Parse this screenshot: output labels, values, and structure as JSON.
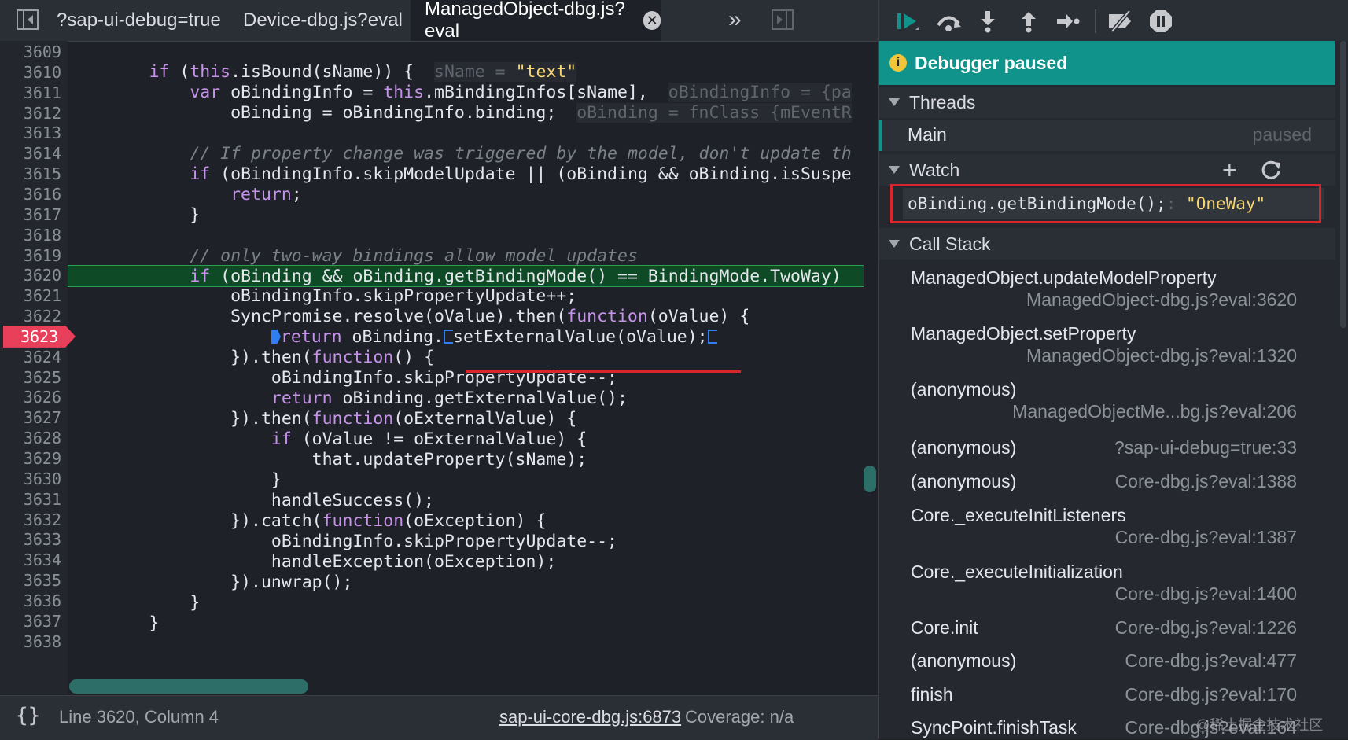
{
  "tabs": [
    {
      "label": "?sap-ui-debug=true",
      "active": false
    },
    {
      "label": "Device-dbg.js?eval",
      "active": false
    },
    {
      "label": "ManagedObject-dbg.js?eval",
      "active": true
    }
  ],
  "tab_close_symbol": "✕",
  "tab_overflow_symbol": "»",
  "line_numbers": [
    "3609",
    "3610",
    "3611",
    "3612",
    "3613",
    "3614",
    "3615",
    "3616",
    "3617",
    "3618",
    "3619",
    "3620",
    "3621",
    "3622",
    "3623",
    "3624",
    "3625",
    "3626",
    "3627",
    "3628",
    "3629",
    "3630",
    "3631",
    "3632",
    "3633",
    "3634",
    "3635",
    "3636",
    "3637",
    "3638"
  ],
  "breakpoint_line": "3623",
  "current_line": "3620",
  "code": {
    "l3610": {
      "a": "        ",
      "kw1": "if",
      "b": " (",
      "kw2": "this",
      "c": ".isBound(sName)) {  ",
      "inl_name": "sName = ",
      "inl_val": "\"text\""
    },
    "l3611": {
      "a": "            ",
      "kw1": "var",
      "b": " oBindingInfo = ",
      "kw2": "this",
      "c": ".mBindingInfos[sName],  ",
      "inl": "oBindingInfo = {pa"
    },
    "l3612": {
      "a": "                oBinding = oBindingInfo.binding;  ",
      "inl": "oBinding = fnClass {mEventR"
    },
    "l3614": {
      "a": "            ",
      "cmt": "// If property change was triggered by the model, don't update th"
    },
    "l3615": {
      "a": "            ",
      "kw1": "if",
      "b": " (oBindingInfo.skipModelUpdate || (oBinding && oBinding.isSuspe"
    },
    "l3616": {
      "a": "                ",
      "kw1": "return",
      "b": ";"
    },
    "l3617": {
      "a": "            }"
    },
    "l3619": {
      "a": "            ",
      "cmt": "// only two-way bindings allow model updates"
    },
    "l3620": {
      "a": "            ",
      "kw1": "if",
      "b": " (oBinding && oBinding.getBindingMode() == BindingMode.TwoWay)"
    },
    "l3621": {
      "a": "                oBindingInfo.skipPropertyUpdate++;"
    },
    "l3622": {
      "a": "                SyncPromise.resolve(oValue).then(",
      "kw1": "function",
      "b": "(oValue) {"
    },
    "l3623": {
      "a": "                    ",
      "kw1": "return",
      "b": " oBinding.",
      "c": "setExternalValue(oValue);"
    },
    "l3624": {
      "a": "                }).then(",
      "kw1": "function",
      "b": "() {"
    },
    "l3625": {
      "a": "                    oBindingInfo.skipPropertyUpdate--;"
    },
    "l3626": {
      "a": "                    ",
      "kw1": "return",
      "b": " oBinding.getExternalValue();"
    },
    "l3627": {
      "a": "                }).then(",
      "kw1": "function",
      "b": "(oExternalValue) {"
    },
    "l3628": {
      "a": "                    ",
      "kw1": "if",
      "b": " (oValue != oExternalValue) {"
    },
    "l3629": {
      "a": "                        that.updateProperty(sName);"
    },
    "l3630": {
      "a": "                    }"
    },
    "l3631": {
      "a": "                    handleSuccess();"
    },
    "l3632": {
      "a": "                }).catch(",
      "kw1": "function",
      "b": "(oException) {"
    },
    "l3633": {
      "a": "                    oBindingInfo.skipPropertyUpdate--;"
    },
    "l3634": {
      "a": "                    handleException(oException);"
    },
    "l3635": {
      "a": "                }).unwrap();"
    },
    "l3636": {
      "a": "            }"
    },
    "l3637": {
      "a": "        }"
    }
  },
  "status": {
    "braces_icon": "{}",
    "position": "Line 3620, Column 4",
    "source_link": "sap-ui-core-dbg.js:6873",
    "coverage": "Coverage: n/a"
  },
  "debugger": {
    "paused_label": "Debugger paused",
    "info_symbol": "i",
    "threads_header": "Threads",
    "thread_name": "Main",
    "thread_state": "paused",
    "watch_header": "Watch",
    "watch_add": "+",
    "watch_expression": "oBinding.getBindingMode();",
    "watch_separator": ":",
    "watch_value": "\"OneWay\"",
    "callstack_header": "Call Stack",
    "frames": [
      {
        "name": "ManagedObject.updateModelProperty",
        "loc": "ManagedObject-dbg.js?eval:3620"
      },
      {
        "name": "ManagedObject.setProperty",
        "loc": "ManagedObject-dbg.js?eval:1320"
      },
      {
        "name": "(anonymous)",
        "loc": "ManagedObjectMe...bg.js?eval:206"
      },
      {
        "name": "(anonymous)",
        "loc": "?sap-ui-debug=true:33"
      },
      {
        "name": "(anonymous)",
        "loc": "Core-dbg.js?eval:1388"
      },
      {
        "name": "Core._executeInitListeners",
        "loc": "Core-dbg.js?eval:1387"
      },
      {
        "name": "Core._executeInitialization",
        "loc": "Core-dbg.js?eval:1400"
      },
      {
        "name": "Core.init",
        "loc": "Core-dbg.js?eval:1226"
      },
      {
        "name": "(anonymous)",
        "loc": "Core-dbg.js?eval:477"
      },
      {
        "name": "finish",
        "loc": "Core-dbg.js?eval:170"
      },
      {
        "name": "SyncPoint.finishTask",
        "loc": "Core-dbg.js?eval:164"
      }
    ]
  },
  "watermark": "@稀土掘金技术社区",
  "colors": {
    "accent_teal": "#10938a",
    "breakpoint_red": "#e8405a",
    "current_line_green": "#0f4a26",
    "highlight_red": "#d9262b",
    "keyword_purple": "#c792ea",
    "string_yellow": "#f7d774"
  }
}
